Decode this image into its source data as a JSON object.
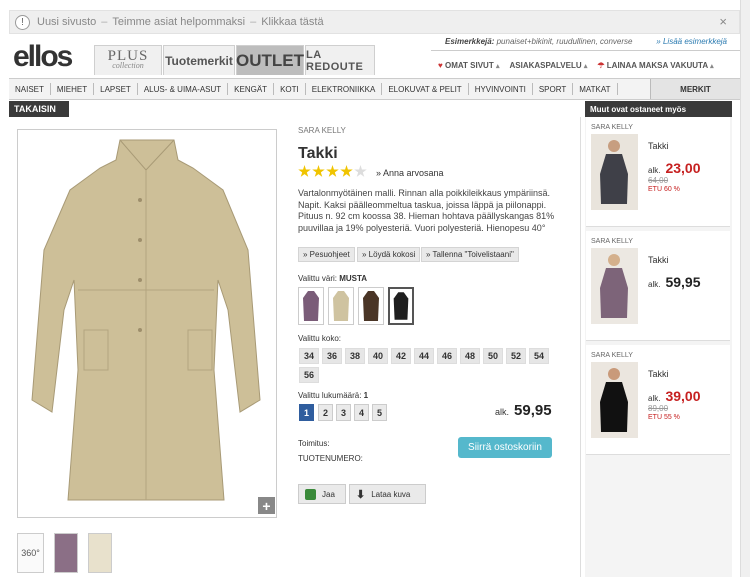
{
  "notice": {
    "new_page": "Uusi sivusto",
    "sep": "–",
    "improved": "Teimme asiat helpommaksi",
    "click_here": "Klikkaa tästä",
    "close": "×"
  },
  "header": {
    "logo": "ellos",
    "tabs": [
      {
        "line1": "PLUS",
        "line2": "collection"
      },
      {
        "label": "Tuotemerkit"
      },
      {
        "label": "OUTLET"
      },
      {
        "label": "LA REDOUTE"
      }
    ],
    "search_prefix": "Esimerkkejä:",
    "search_examples": "punaiset+bikinit, ruudullinen, converse",
    "search_more": "» Lisää esimerkkejä",
    "links": [
      "OMAT SIVUT",
      "ASIAKASPALVELU",
      "LAINAA MAKSA VAKUUTA"
    ]
  },
  "menu": {
    "items": [
      "NAISET",
      "MIEHET",
      "LAPSET",
      "ALUS- & UIMA-ASUT",
      "KENGÄT",
      "KOTI",
      "ELEKTRONIIKKA",
      "ELOKUVAT & PELIT",
      "HYVINVOINTI",
      "SPORT",
      "MATKAT"
    ],
    "brands": "MERKIT"
  },
  "back": "TAKAISIN",
  "product": {
    "brand": "SARA KELLY",
    "title": "Takki",
    "rating": 4,
    "rate_link": "» Anna arvosana",
    "description": "Vartalonmyötäinen malli. Rinnan alla poikkileikkaus ympäriinsä. Napit. Kaksi päälleommeltua taskua, joissa läppä ja piilonappi. Pituus n. 92 cm koossa 38. Hieman hohtava päällyskangas 81% puuvillaa ja 19% polyesteriä. Vuori polyesteriä. Hienopesu 40°",
    "buttons": [
      "» Pesuohjeet",
      "» Löydä kokosi",
      "» Tallenna \"Toivelistaani\""
    ],
    "color_label": "Valittu väri:",
    "color_value": "MUSTA",
    "colors": [
      {
        "name": "lilac",
        "hex": "#7a5c78"
      },
      {
        "name": "beige",
        "hex": "#cfc3a0"
      },
      {
        "name": "brown",
        "hex": "#4a3526"
      },
      {
        "name": "black",
        "hex": "#1f1f1f"
      }
    ],
    "size_label": "Valittu koko:",
    "sizes": [
      "34",
      "36",
      "38",
      "40",
      "42",
      "44",
      "46",
      "48",
      "50",
      "52",
      "54",
      "56"
    ],
    "qty_label": "Valittu lukumäärä:",
    "qty_value": "1",
    "qtys": [
      "1",
      "2",
      "3",
      "4",
      "5"
    ],
    "price_prefix": "alk.",
    "price": "59,95",
    "delivery": "Toimitus:",
    "product_no": "TUOTENUMERO:",
    "cart": "Siirrä ostoskoriin",
    "share": "Jaa",
    "download": "Lataa kuva",
    "zoom": "+",
    "thumb_360": "360°"
  },
  "sidebar": {
    "title": "Muut ovat ostaneet myös",
    "items": [
      {
        "brand": "SARA KELLY",
        "name": "Takki",
        "prefix": "alk.",
        "price": "23,00",
        "old": "64,00",
        "discount": "ETU 60 %",
        "red": true,
        "coat": "#3f4048"
      },
      {
        "brand": "SARA KELLY",
        "name": "Takki",
        "prefix": "alk.",
        "price": "59,95",
        "old": "",
        "discount": "",
        "red": false,
        "coat": "#7d6479"
      },
      {
        "brand": "SARA KELLY",
        "name": "Takki",
        "prefix": "alk.",
        "price": "39,00",
        "old": "89,00",
        "discount": "ETU 55 %",
        "red": true,
        "coat": "#111"
      }
    ]
  }
}
